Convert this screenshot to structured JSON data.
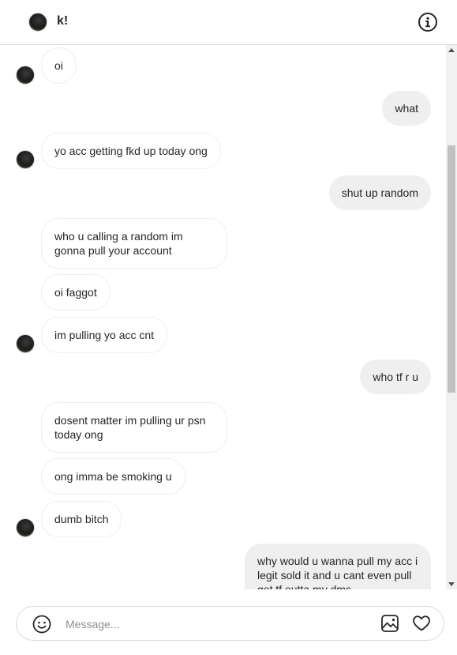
{
  "header": {
    "username": "k!",
    "avatar_icon": "profile-avatar",
    "info_icon": "info-icon"
  },
  "messages": [
    {
      "from": "them",
      "text": "oi"
    },
    {
      "from": "me",
      "text": "what"
    },
    {
      "from": "them",
      "text": "yo acc getting fkd up today ong"
    },
    {
      "from": "me",
      "text": "shut up random"
    },
    {
      "from": "them",
      "text": "who u calling a random im gonna pull your account"
    },
    {
      "from": "them",
      "text": "oi faggot"
    },
    {
      "from": "them",
      "text": "im pulling yo acc cnt"
    },
    {
      "from": "me",
      "text": "who tf r u"
    },
    {
      "from": "them",
      "text": "dosent matter im pulling ur psn today ong"
    },
    {
      "from": "them",
      "text": "ong imma be smoking u"
    },
    {
      "from": "them",
      "text": "dumb bitch"
    },
    {
      "from": "me",
      "text": "why would u wanna pull my acc i legit sold it and u cant even pull get tf outta my dms"
    }
  ],
  "composer": {
    "placeholder": "Message...",
    "emoji_icon": "emoji-icon",
    "image_icon": "image-icon",
    "heart_icon": "heart-icon"
  },
  "colors": {
    "incoming_border": "#efefef",
    "outgoing_bg": "#efefef",
    "divider": "#dbdbdb",
    "text": "#262626",
    "placeholder": "#8e8e8e"
  }
}
